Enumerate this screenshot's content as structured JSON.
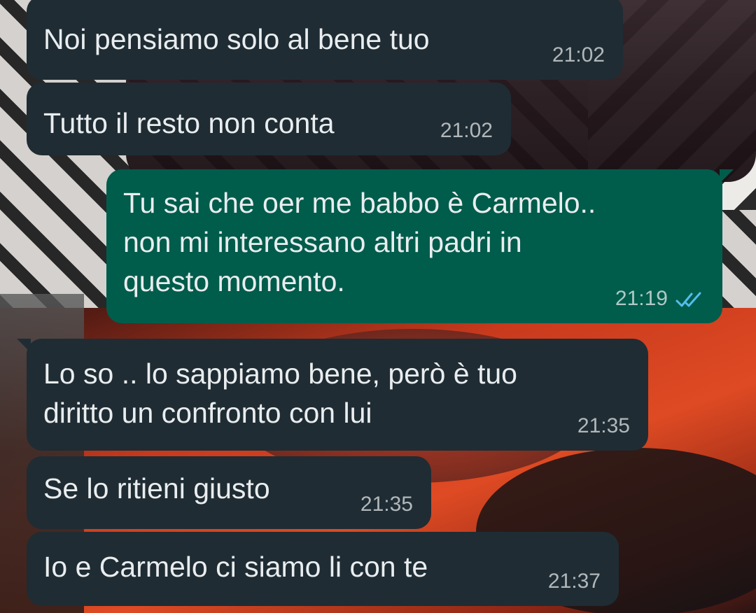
{
  "messages": [
    {
      "direction": "incoming",
      "text": "Noi pensiamo solo al bene tuo",
      "time": "21:02"
    },
    {
      "direction": "incoming",
      "text": "Tutto il resto non conta",
      "time": "21:02"
    },
    {
      "direction": "outgoing",
      "text": "Tu sai che oer me babbo è Carmelo..\nnon mi interessano altri padri in\nquesto momento.",
      "time": "21:19",
      "status": "read",
      "status_icon": "double-check-icon",
      "status_color": "#53bdeb"
    },
    {
      "direction": "incoming",
      "text": "Lo so .. lo sappiamo bene, però è tuo\ndiritto un confronto con lui",
      "time": "21:35"
    },
    {
      "direction": "incoming",
      "text": "Se lo ritieni giusto",
      "time": "21:35"
    },
    {
      "direction": "incoming",
      "text": "Io e Carmelo ci siamo li con te",
      "time": "21:37"
    }
  ],
  "colors": {
    "incoming_bubble": "#1f2c33",
    "outgoing_bubble": "#005c4b",
    "text": "#e9edef",
    "read_ticks": "#53bdeb"
  }
}
